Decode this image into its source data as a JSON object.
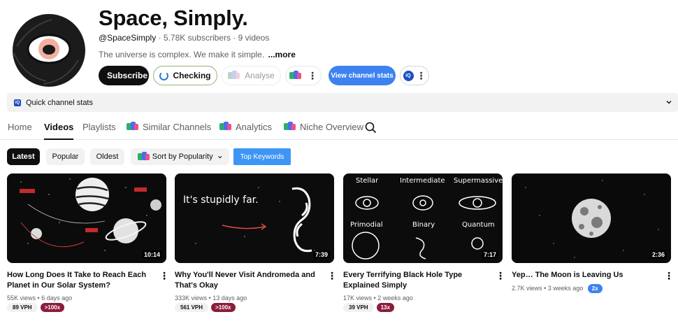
{
  "channel": {
    "title": "Space, Simply.",
    "handle": "@SpaceSimply",
    "subscribers": "5.78K subscribers",
    "videos": "9 videos",
    "description": "The universe is complex. We make it simple.",
    "more_label": "...more"
  },
  "actions": {
    "subscribe_label": "Subscribe",
    "checking_label": "Checking",
    "analyse_label": "Analyse",
    "view_stats_label": "View channel stats"
  },
  "quick_stats": {
    "label": "Quick channel stats"
  },
  "tabs": [
    {
      "label": "Home"
    },
    {
      "label": "Videos"
    },
    {
      "label": "Playlists"
    },
    {
      "label": "Similar Channels"
    },
    {
      "label": "Analytics"
    },
    {
      "label": "Niche Overview"
    }
  ],
  "filters": {
    "latest": "Latest",
    "popular": "Popular",
    "oldest": "Oldest",
    "sort_label": "Sort by Popularity",
    "top_keywords": "Top Keywords"
  },
  "videos": [
    {
      "title": "How Long Does It Take to Reach Each Planet in Our Solar System?",
      "views": "55K views",
      "age": "6 days ago",
      "duration": "10:14",
      "vph": "89 VPH",
      "multiplier": ">100x"
    },
    {
      "title": "Why You'll Never Visit Andromeda and That's Okay",
      "views": "333K views",
      "age": "13 days ago",
      "duration": "7:39",
      "vph": "561 VPH",
      "multiplier": ">100x",
      "thumb_text": "It's stupidly far."
    },
    {
      "title": "Every Terrifying Black Hole Type Explained Simply",
      "views": "17K views",
      "age": "2 weeks ago",
      "duration": "7:17",
      "vph": "39 VPH",
      "multiplier": "13x",
      "thumb_labels": [
        "Stellar",
        "Intermediate",
        "Supermassive",
        "Primodial",
        "Binary",
        "Quantum"
      ]
    },
    {
      "title": "Yep… The Moon is Leaving Us",
      "views": "2.7K views",
      "age": "3 weeks ago",
      "duration": "2:36",
      "multiplier": "2x"
    }
  ],
  "colors": {
    "accent_blue": "#3e82f0",
    "multiplier_red": "#8b1d3c",
    "text_primary": "#0f0f0f",
    "text_secondary": "#606060"
  }
}
